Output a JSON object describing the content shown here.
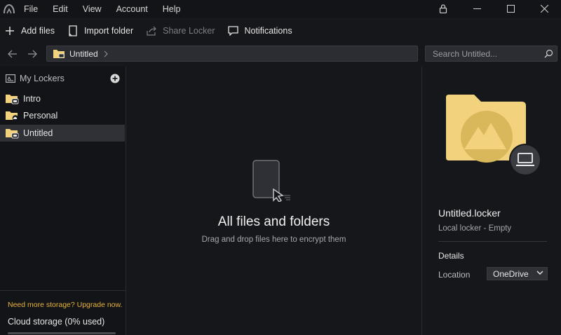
{
  "menu": {
    "items": [
      "File",
      "Edit",
      "View",
      "Account",
      "Help"
    ]
  },
  "toolbar": {
    "add_files": "Add files",
    "import_folder": "Import folder",
    "share_locker": "Share Locker",
    "notifications": "Notifications"
  },
  "breadcrumb": {
    "current": "Untitled"
  },
  "search": {
    "placeholder": "Search Untitled..."
  },
  "sidebar": {
    "header": "My Lockers",
    "items": [
      {
        "label": "Intro",
        "badge": "laptop",
        "selected": false
      },
      {
        "label": "Personal",
        "badge": "cloud",
        "selected": false
      },
      {
        "label": "Untitled",
        "badge": "laptop",
        "selected": true
      }
    ],
    "upgrade_text": "Need more storage? Upgrade now.",
    "cloud_storage": "Cloud storage (0% used)",
    "cloud_used_percent": 0
  },
  "main": {
    "empty_title": "All files and folders",
    "empty_subtitle": "Drag and drop files here to encrypt them"
  },
  "details": {
    "name": "Untitled.locker",
    "subtitle": "Local locker - Empty",
    "section": "Details",
    "location_label": "Location",
    "location_value": "OneDrive"
  },
  "colors": {
    "accent_folder": "#f3d27e",
    "upgrade_link": "#e8b33a",
    "background": "#16171b",
    "selection": "#2f3137"
  }
}
